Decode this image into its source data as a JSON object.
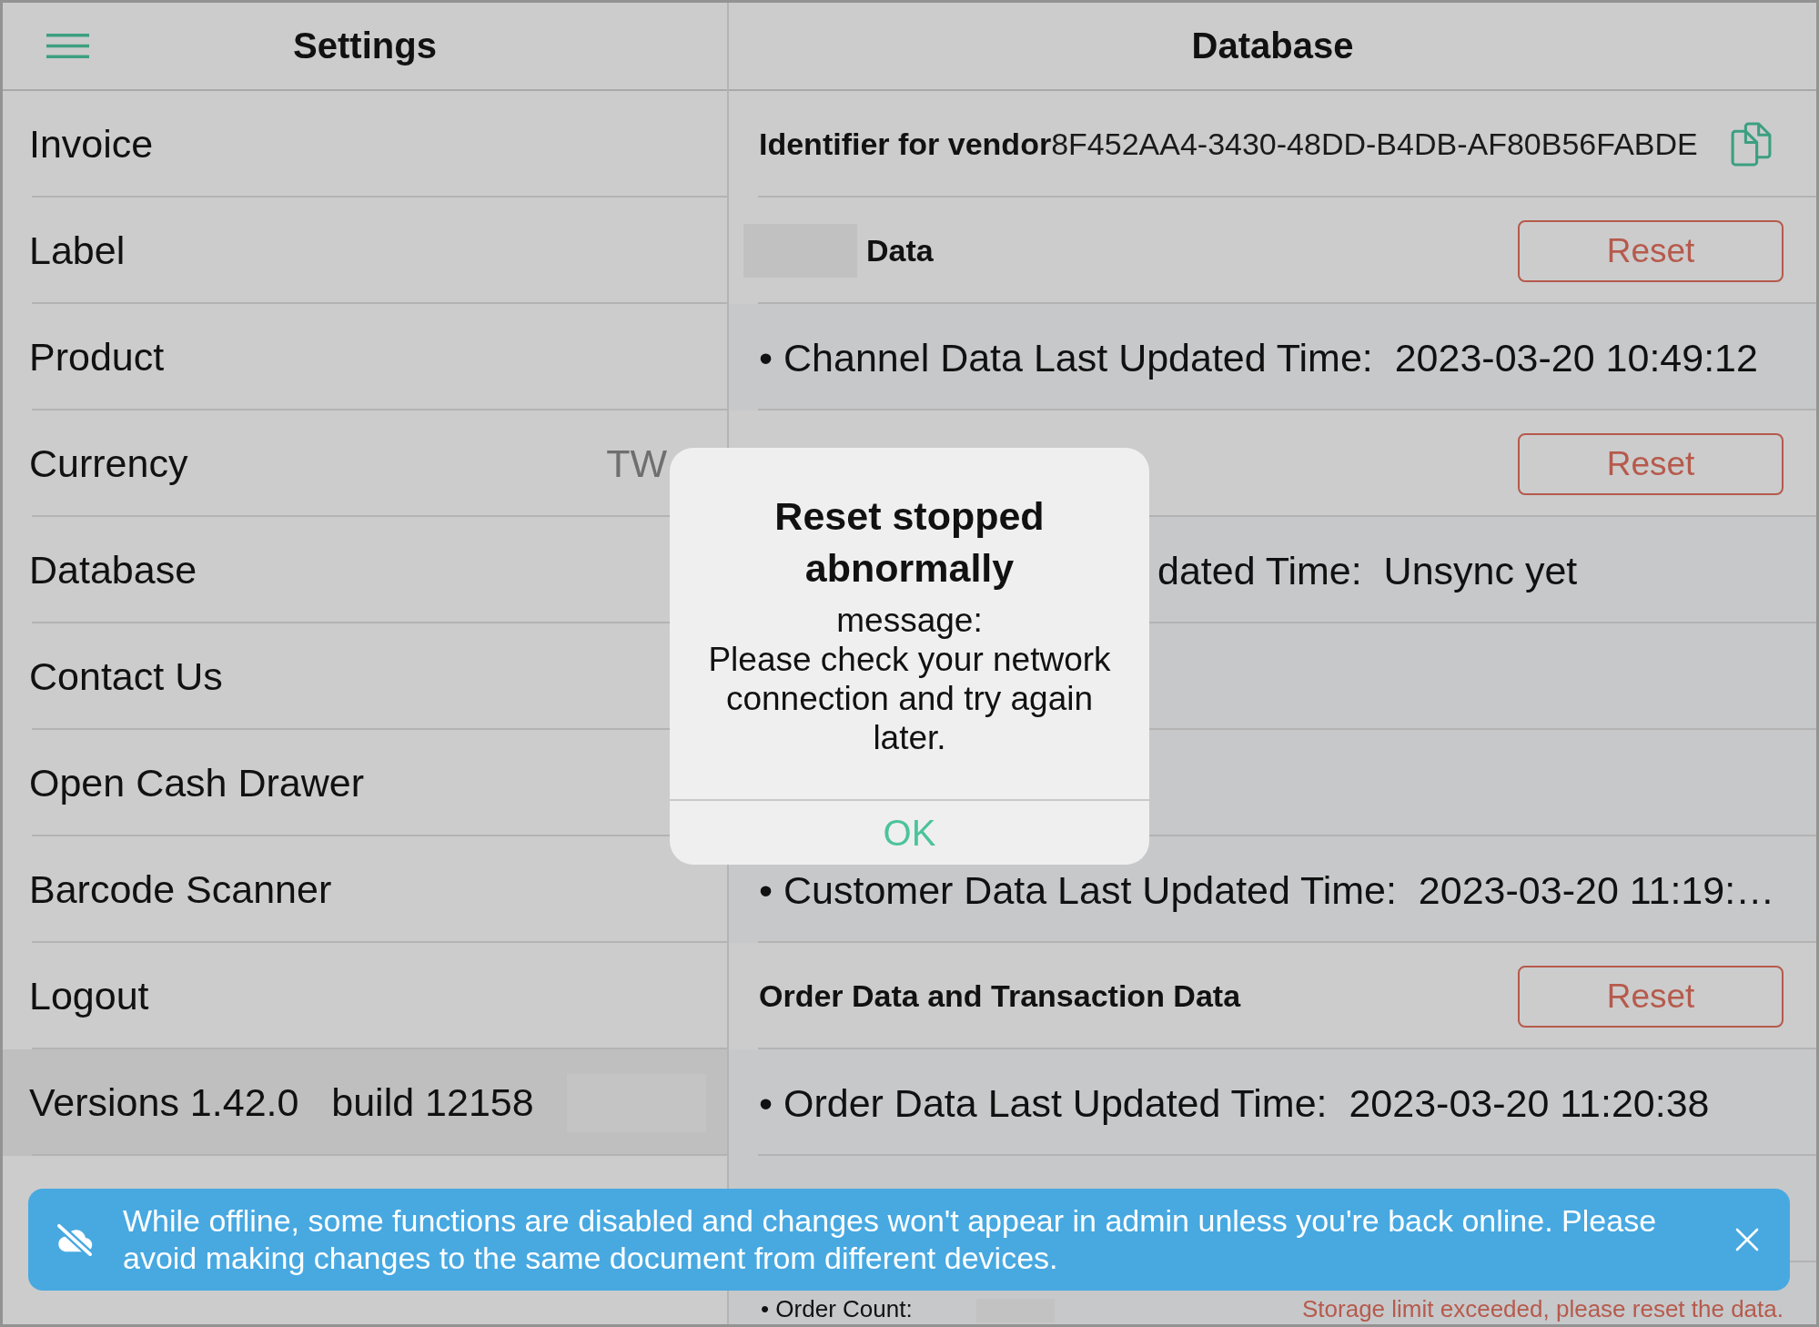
{
  "settings": {
    "title": "Settings",
    "items": [
      {
        "label": "Invoice"
      },
      {
        "label": "Label"
      },
      {
        "label": "Product"
      },
      {
        "label": "Currency",
        "value": "TW"
      },
      {
        "label": "Database"
      },
      {
        "label": "Contact Us"
      },
      {
        "label": "Open Cash Drawer"
      },
      {
        "label": "Barcode Scanner"
      },
      {
        "label": "Logout"
      }
    ],
    "version": {
      "text": "Versions 1.42.0   build 12158",
      "masked": true
    }
  },
  "database": {
    "title": "Database",
    "rows": [
      {
        "kind": "identifier",
        "label": "Identifier for vendor",
        "value": "8F452AA4-3430-48DD-B4DB-AF80B56FABDE"
      },
      {
        "kind": "section",
        "masked": true,
        "label": "Data",
        "button": "Reset"
      },
      {
        "kind": "time",
        "text": "• Channel Data Last Updated Time:  2023-03-20 10:49:12"
      },
      {
        "kind": "section",
        "button": "Reset"
      },
      {
        "kind": "partial",
        "text": "dated Time:  Unsync yet"
      },
      {
        "kind": "blank"
      },
      {
        "kind": "blank"
      },
      {
        "kind": "time",
        "text": "• Customer Data Last Updated Time:  2023-03-20 11:19:…"
      },
      {
        "kind": "section",
        "label": "Order Data and Transaction Data",
        "button": "Reset"
      },
      {
        "kind": "time",
        "text": "• Order Data Last Updated Time:  2023-03-20 11:20:38"
      },
      {
        "kind": "blank"
      },
      {
        "kind": "count",
        "label": "• Order Count:",
        "masked": true,
        "warning": "Storage limit exceeded, please reset the data."
      }
    ]
  },
  "dialog": {
    "title": "Reset stopped abnormally",
    "message": "message:\nPlease check your network connection and try again later.",
    "button": "OK"
  },
  "banner": {
    "message": "While offline, some functions are disabled and changes won't appear in admin unless you're back online. Please avoid making changes to the same document from different devices."
  }
}
